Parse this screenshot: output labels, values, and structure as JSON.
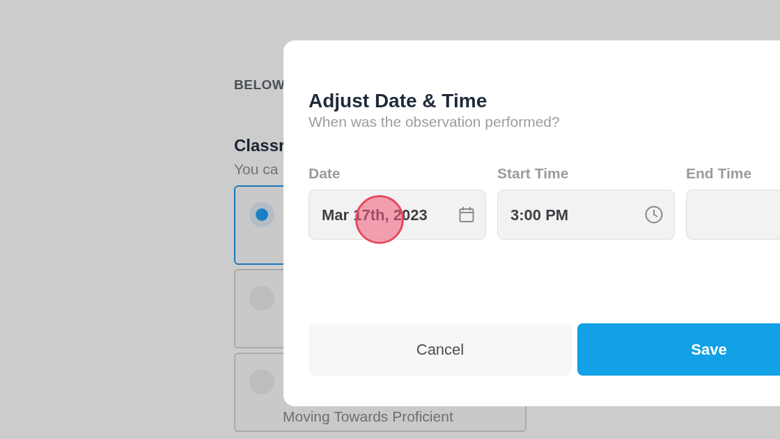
{
  "background": {
    "section_label": "BELOW",
    "heading": "Classr",
    "hint": "You ca",
    "options": [
      {
        "selected": true
      },
      {
        "selected": false
      },
      {
        "selected": false,
        "label": "Moving Towards Proficient"
      }
    ]
  },
  "dialog": {
    "title": "Adjust Date & Time",
    "subtitle": "When was the observation performed?",
    "fields": [
      {
        "label": "Date",
        "value": "Mar 17th, 2023",
        "kind": "date"
      },
      {
        "label": "Start Time",
        "value": "3:00 PM",
        "kind": "time"
      },
      {
        "label": "End Time",
        "kind": "plain"
      }
    ],
    "buttons": [
      {
        "label": "Cancel",
        "kind": "secondary"
      },
      {
        "label": "Save",
        "kind": "primary"
      }
    ]
  }
}
